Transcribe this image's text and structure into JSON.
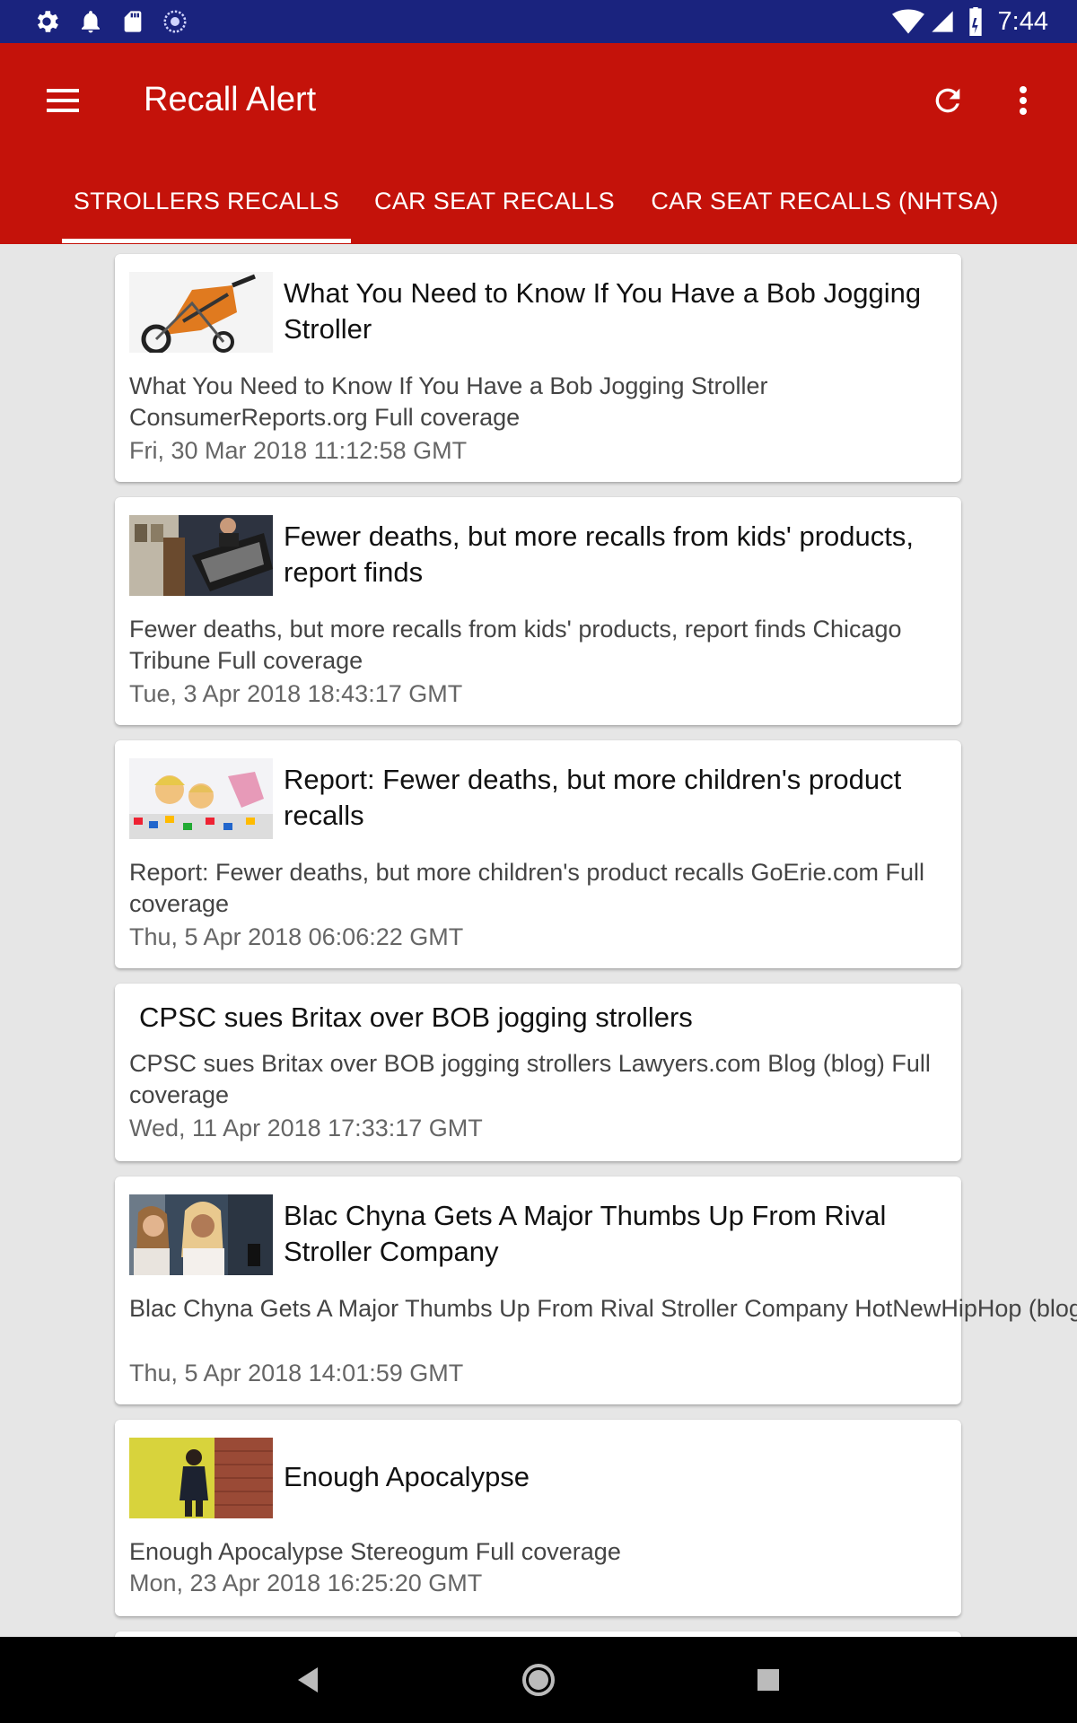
{
  "status": {
    "time": "7:44",
    "left_icons": [
      "gear-icon",
      "bell-icon",
      "sd-card-icon",
      "sync-icon"
    ],
    "right_icons": [
      "wifi-icon",
      "signal-icon",
      "battery-icon"
    ]
  },
  "appbar": {
    "title": "Recall Alert",
    "bg_color": "#c4120a"
  },
  "tabs": [
    {
      "label": "STROLLERS RECALLS",
      "selected": true
    },
    {
      "label": "CAR SEAT RECALLS",
      "selected": false
    },
    {
      "label": "CAR SEAT RECALLS (NHTSA)",
      "selected": false
    }
  ],
  "articles": [
    {
      "title": "What You Need to Know If You Have a Bob Jogging Stroller",
      "desc": "What You Need to Know If You Have a Bob Jogging Stroller  ConsumerReports.org  Full coverage",
      "date": "Fri, 30 Mar 2018 11:12:58 GMT",
      "thumbnail": "stroller-photo"
    },
    {
      "title": "Fewer deaths, but more recalls from kids' products, report finds",
      "desc": "Fewer deaths, but more recalls from kids' products, report finds  Chicago Tribune  Full coverage",
      "date": "Tue, 3 Apr 2018 18:43:17 GMT",
      "thumbnail": "press-conference-photo"
    },
    {
      "title": "Report: Fewer deaths, but more children's product recalls",
      "desc": "Report: Fewer deaths, but more children's product recalls  GoErie.com  Full coverage",
      "date": "Thu, 5 Apr 2018 06:06:22 GMT",
      "thumbnail": "children-toys-photo"
    },
    {
      "title": "CPSC sues Britax over BOB jogging strollers",
      "desc": "CPSC sues Britax over BOB jogging strollers  Lawyers.com Blog (blog)  Full coverage",
      "date": "Wed, 11 Apr 2018 17:33:17 GMT",
      "thumbnail": ""
    },
    {
      "title": "Blac Chyna Gets A Major Thumbs Up From Rival Stroller Company",
      "desc": "Blac Chyna Gets A Major Thumbs Up From Rival Stroller Company  HotNewHipHop (blog)  Blac Chyna Loses Stroller Endorsement Deal Ov…",
      "date": "Thu, 5 Apr 2018 14:01:59 GMT",
      "thumbnail": "celebrity-photo"
    },
    {
      "title": "Enough Apocalypse",
      "desc": "Enough Apocalypse  Stereogum  Full coverage",
      "date": "Mon, 23 Apr 2018 16:25:20 GMT",
      "thumbnail": "person-brick-wall-photo"
    }
  ]
}
